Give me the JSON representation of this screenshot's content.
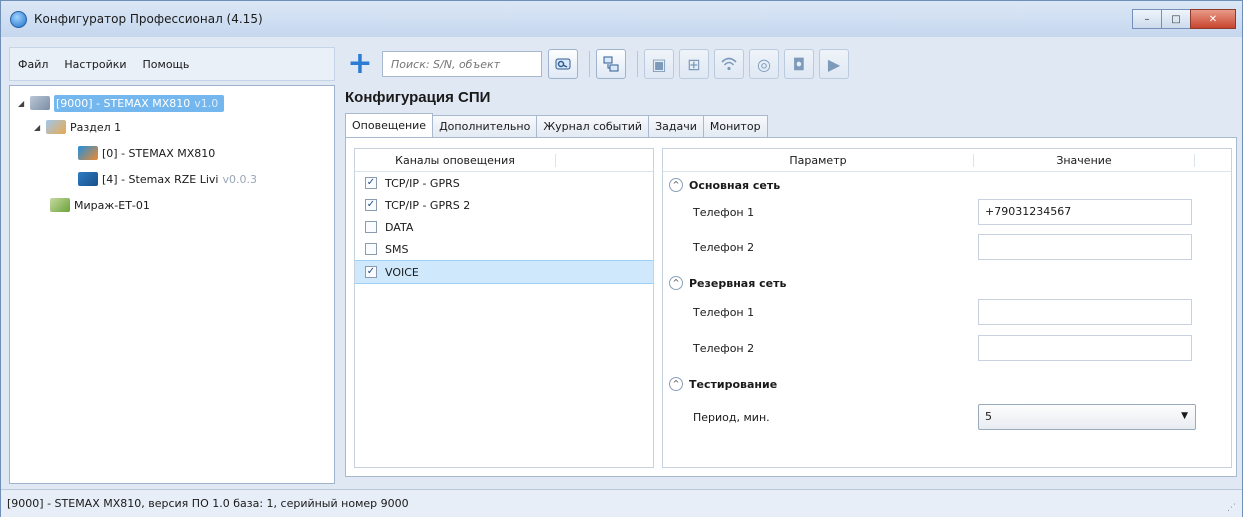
{
  "window": {
    "title": "Конфигуратор Профессионал (4.15)",
    "min": "–",
    "max": "□",
    "close": "✕"
  },
  "menu": [
    "Файл",
    "Настройки",
    "Помощь"
  ],
  "toolbar": {
    "add_label": "+",
    "search_placeholder": "Поиск: S/N, объект"
  },
  "tree": [
    {
      "label": "[9000] - STEMAX MX810",
      "version": "v1.0"
    },
    {
      "label": "Раздел 1"
    },
    {
      "label": "[0] - STEMAX MX810"
    },
    {
      "label": "[4] - Stemax RZE Livi",
      "version": "v0.0.3"
    },
    {
      "label": "Мираж-ЕТ-01"
    }
  ],
  "page_title": "Конфигурация СПИ",
  "tabs": [
    "Оповещение",
    "Дополнительно",
    "Журнал событий",
    "Задачи",
    "Монитор"
  ],
  "channels": {
    "header": "Каналы оповещения",
    "items": [
      {
        "label": "TCP/IP - GPRS",
        "checked": "✓"
      },
      {
        "label": "TCP/IP - GPRS 2",
        "checked": "✓"
      },
      {
        "label": "DATA",
        "checked": ""
      },
      {
        "label": "SMS",
        "checked": ""
      },
      {
        "label": "VOICE",
        "checked": "✓"
      }
    ]
  },
  "params": {
    "header_param": "Параметр",
    "header_value": "Значение",
    "group_main": "Основная сеть",
    "group_reserve": "Резервная сеть",
    "group_test": "Тестирование",
    "phone1": "Телефон 1",
    "phone2": "Телефон 2",
    "main_phone1_value": "+79031234567",
    "period_label": "Период, мин.",
    "period_value": "5"
  },
  "status": "[9000] - STEMAX MX810, версия ПО 1.0 база: 1, серийный номер 9000"
}
